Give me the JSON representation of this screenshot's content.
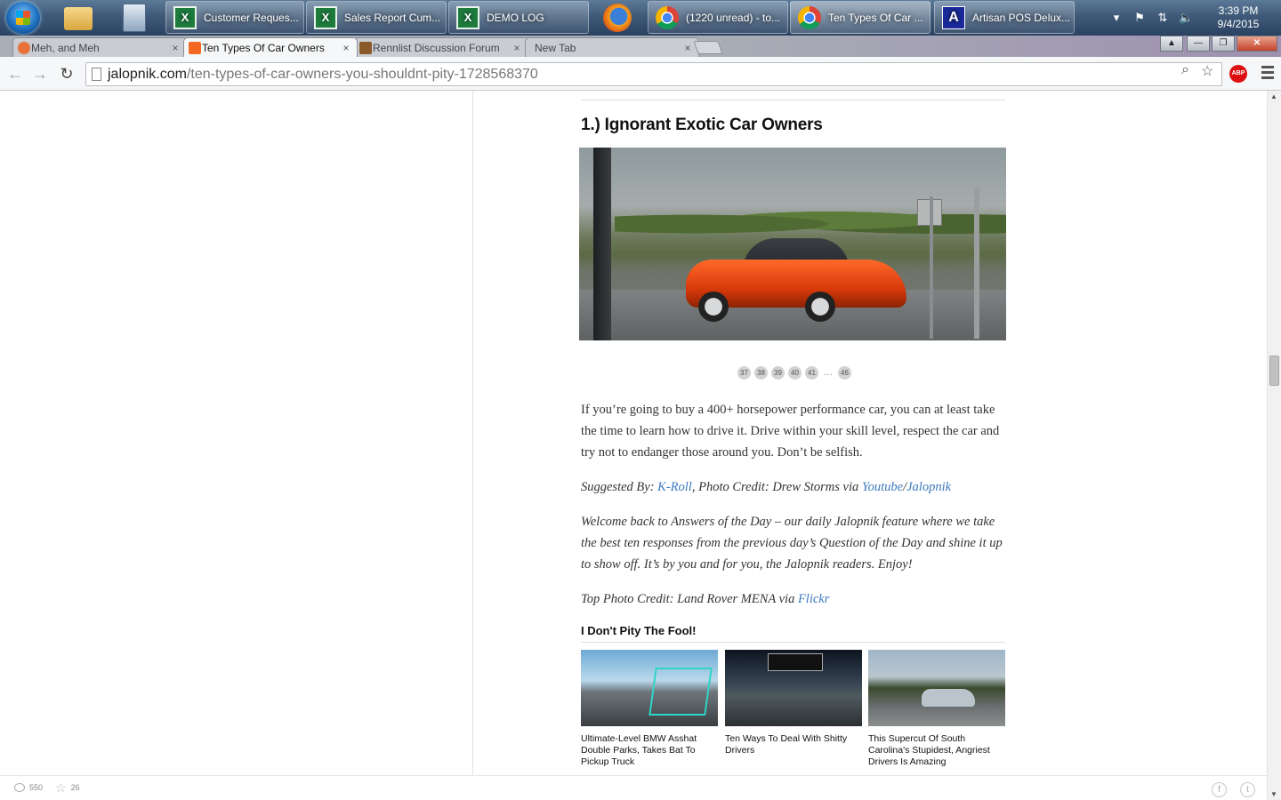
{
  "taskbar": {
    "buttons": [
      {
        "label": "Customer Reques..."
      },
      {
        "label": "Sales Report Cum..."
      },
      {
        "label": "DEMO LOG"
      },
      {
        "label": "(1220 unread) - to..."
      },
      {
        "label": "Ten Types Of Car ..."
      },
      {
        "label": "Artisan POS Delux..."
      }
    ],
    "excel_icon": "X",
    "clock": {
      "time": "3:39 PM",
      "date": "9/4/2015"
    }
  },
  "browser": {
    "tabs": [
      {
        "title": "Meh, and Meh",
        "close": "×",
        "favicon_color": "#e8703a"
      },
      {
        "title": "Ten Types Of Car Owners",
        "close": "×",
        "favicon_color": "#f26a21",
        "active": true
      },
      {
        "title": "Rennlist Discussion Forum",
        "close": "×",
        "favicon_color": "#8b5a2b"
      },
      {
        "title": "New Tab",
        "close": "×"
      }
    ],
    "url_domain": "jalopnik.com",
    "url_path": "/ten-types-of-car-owners-you-shouldnt-pity-1728568370",
    "abp_label": "ABP"
  },
  "article": {
    "heading": "1.) Ignorant Exotic Car Owners",
    "pager": {
      "pages": [
        "37",
        "38",
        "39",
        "40",
        "41"
      ],
      "ellipsis": "…",
      "last": "46"
    },
    "paragraph1": "If you’re going to buy a 400+ horsepower performance car, you can at least take the time to learn how to drive it. Drive within your skill level, respect the car and try not to endanger those around you. Don’t be selfish.",
    "credit": {
      "prefix": "Suggested By: ",
      "author_link": "K-Roll",
      "middle": ", Photo Credit: Drew Storms via ",
      "link1": "Youtube",
      "slash": "/",
      "link2": "Jalopnik"
    },
    "paragraph3": "Welcome back to Answers of the Day – our daily Jalopnik feature where we take the best ten responses from the previous day’s Question of the Day and shine it up to show off. It’s by you and for you, the Jalopnik readers. Enjoy!",
    "top_photo": {
      "prefix": "Top Photo Credit: Land Rover MENA via ",
      "link": "Flickr"
    }
  },
  "related": {
    "title": "I Don't Pity The Fool!",
    "items": [
      {
        "caption": "Ultimate-Level BMW Asshat Double Parks, Takes Bat To Pickup Truck"
      },
      {
        "caption": "Ten Ways To Deal With Shitty Drivers"
      },
      {
        "caption": "This Supercut Of South Carolina's Stupidest, Angriest Drivers Is Amazing"
      }
    ]
  },
  "footer": {
    "comments_count": "550",
    "stars_count": "26"
  },
  "colors": {
    "link": "#3b79c0",
    "accent_orange": "#f26a21"
  }
}
